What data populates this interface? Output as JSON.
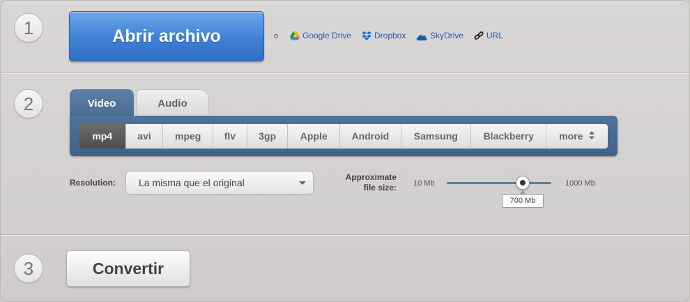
{
  "steps": [
    "1",
    "2",
    "3"
  ],
  "open": {
    "button_label": "Abrir archivo",
    "or_text": "o",
    "sources": [
      {
        "label": "Google Drive",
        "icon": "google-drive-icon"
      },
      {
        "label": "Dropbox",
        "icon": "dropbox-icon"
      },
      {
        "label": "SkyDrive",
        "icon": "skydrive-icon"
      },
      {
        "label": "URL",
        "icon": "link-icon"
      }
    ]
  },
  "tabs": {
    "video": "Video",
    "audio": "Audio",
    "active": "Video"
  },
  "formats": [
    "mp4",
    "avi",
    "mpeg",
    "flv",
    "3gp",
    "Apple",
    "Android",
    "Samsung",
    "Blackberry",
    "more"
  ],
  "selected_format": "mp4",
  "resolution": {
    "label": "Resolution:",
    "value": "La misma que el original"
  },
  "file_size": {
    "label_line1": "Approximate",
    "label_line2": "file size:",
    "min_label": "10 Mb",
    "max_label": "1000 Mb",
    "value_label": "700 Mb",
    "level_fraction": 0.7
  },
  "convert": {
    "button_label": "Convertir"
  },
  "colors": {
    "accent_blue": "#3f81d6",
    "tab_blue": "#4a6d93",
    "link_blue": "#2c5aa5"
  }
}
